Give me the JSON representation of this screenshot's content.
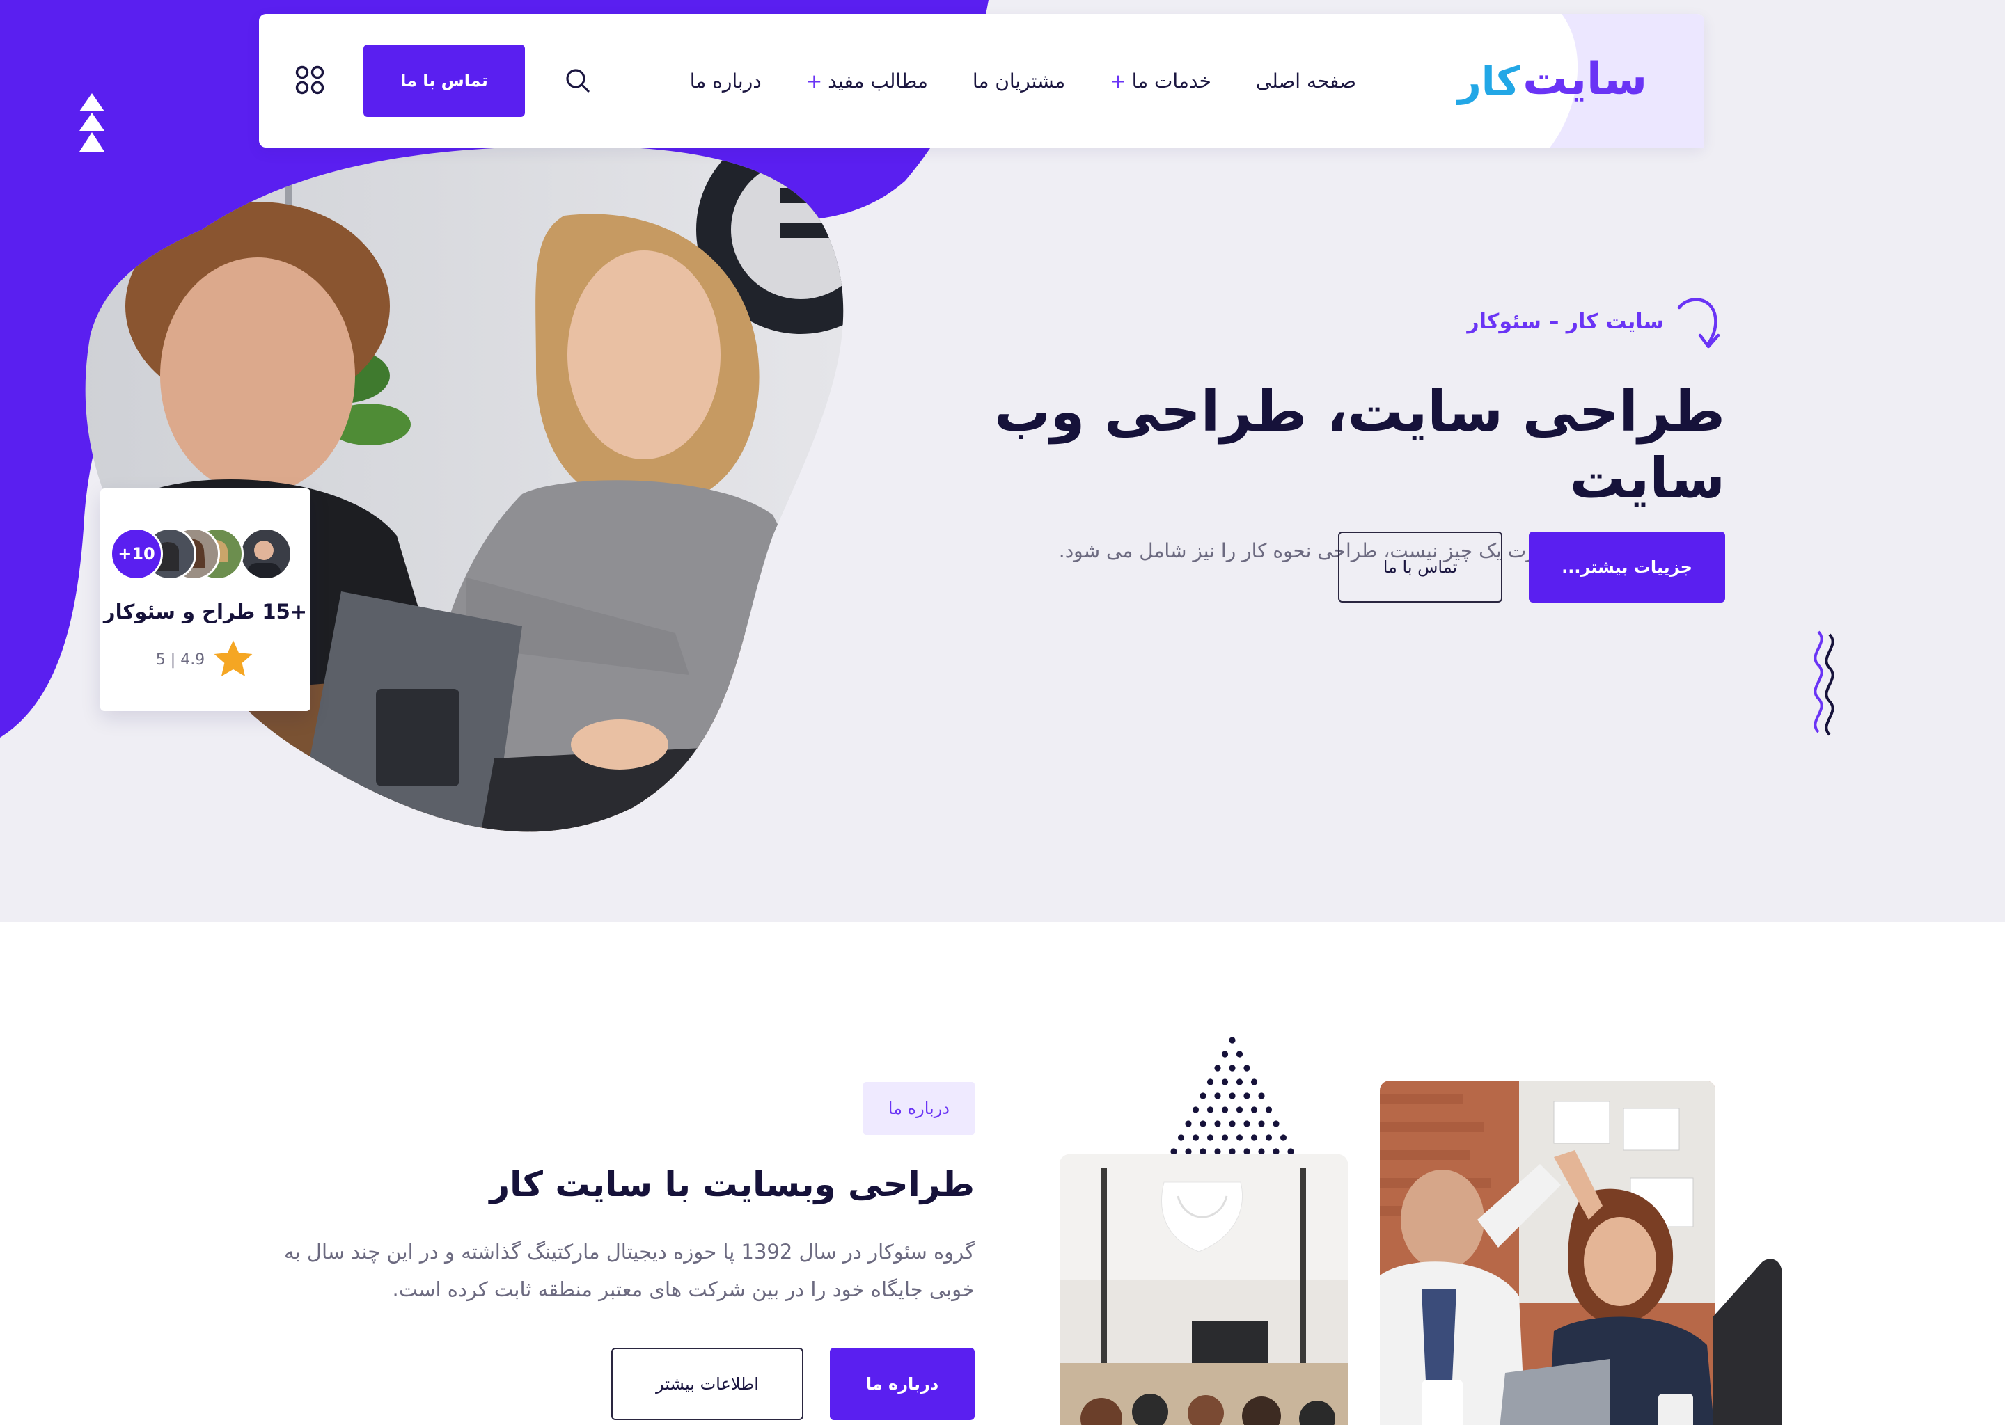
{
  "nav": {
    "logo_part1": "سایت",
    "logo_part2": "کار",
    "items": [
      {
        "label": "صفحه اصلی",
        "has_submenu": false
      },
      {
        "label": "خدمات ما",
        "has_submenu": true
      },
      {
        "label": "مشتریان ما",
        "has_submenu": false
      },
      {
        "label": "مطالب مفید",
        "has_submenu": true
      },
      {
        "label": "درباره ما",
        "has_submenu": false
      }
    ],
    "plus_symbol": "+",
    "cta_label": "تماس با ما",
    "icons": {
      "search": "search-icon",
      "menu_grid": "grid-menu-icon"
    }
  },
  "hero": {
    "eyebrow": "سایت کار – سئوکار",
    "title": "طراحی سایت، طراحی وب سایت",
    "subtitle": "طراحی تنها ظاهر و صورت یک چیز نیست، طراحی نحوه کار را نیز شامل می شود.",
    "primary_button": "جزییات بیشتر...",
    "secondary_button": "تماس با ما"
  },
  "team_card": {
    "more_count": "+10",
    "title": "+15 طراح و سئوکار",
    "rating": "5 | 4.9"
  },
  "about": {
    "chip": "درباره ما",
    "title": "طراحی وبسایت با سایت کار",
    "body": "گروه سئوکار در سال 1392 پا حوزه دیجیتال مارکتینگ گذاشته و در این چند سال به خوبی جایگاه خود را در بین شرکت های معتبر منطقه ثابت کرده است.",
    "primary_button": "درباره ما",
    "secondary_button": "اطلاعات بیشتر"
  },
  "colors": {
    "brand_purple": "#5a1ff0",
    "accent_purple": "#6a34f5",
    "logo_blue": "#22a7e6",
    "hero_bg": "#efeef4",
    "dark_text": "#16123a"
  }
}
